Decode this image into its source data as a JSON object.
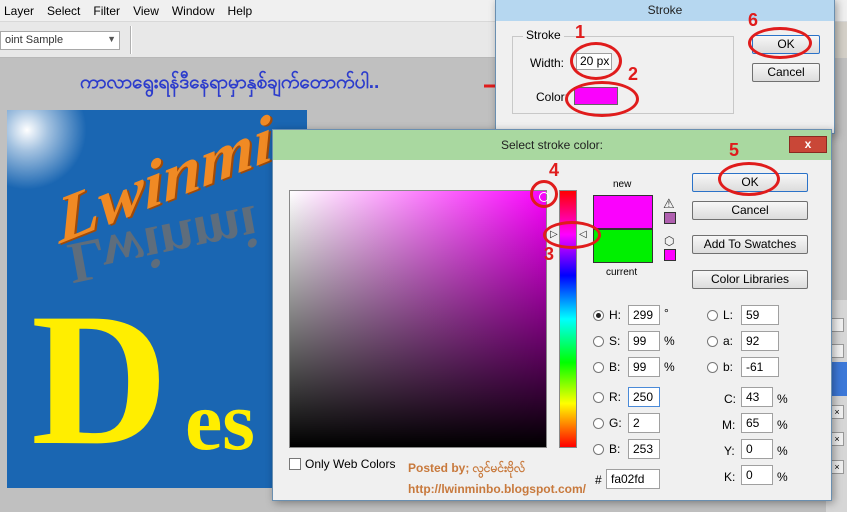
{
  "menu": [
    "Layer",
    "Select",
    "Filter",
    "View",
    "Window",
    "Help"
  ],
  "options_bar": {
    "sample_value": "oint Sample"
  },
  "artwork": {
    "word": "Lwinmi",
    "big_d": "D",
    "big_es": "es"
  },
  "instruction_text": "ကာလာရွေးရန်ဒီနေရာမှာနှစ်ချက်တောက်ပါ..",
  "stroke_dialog": {
    "title": "Stroke",
    "group_title": "Stroke",
    "width_label": "Width:",
    "width_value": "20 px",
    "color_label": "Color:",
    "ok_label": "OK",
    "cancel_label": "Cancel",
    "color_value": "#fa02fd"
  },
  "picker": {
    "title": "Select stroke color:",
    "close_label": "x",
    "label_new": "new",
    "label_current": "current",
    "ok_label": "OK",
    "cancel_label": "Cancel",
    "add_swatches_label": "Add To Swatches",
    "color_libraries_label": "Color Libraries",
    "only_web_label": "Only Web Colors",
    "hex_prefix": "#",
    "hex_value": "fa02fd",
    "new_color": "#fa02fd",
    "current_color": "#00f000",
    "hsb": {
      "H": "299",
      "S": "99",
      "B": "99",
      "h_unit": "°",
      "s_unit": "%",
      "b_unit": "%"
    },
    "rgb": {
      "R": "250",
      "G": "2",
      "B": "253"
    },
    "lab": {
      "L": "59",
      "a": "92",
      "b": "-61"
    },
    "cmyk": {
      "C": "43",
      "M": "65",
      "Y": "0",
      "K": "0",
      "unit": "%"
    },
    "labels": {
      "H": "H:",
      "S": "S:",
      "Bb": "B:",
      "R": "R:",
      "G": "G:",
      "Br": "B:",
      "L": "L:",
      "a": "a:",
      "b": "b:",
      "C": "C:",
      "M": "M:",
      "Y": "Y:",
      "K": "K:"
    }
  },
  "posted_by": "Posted by; လွင်မင်းဗိုလ်",
  "blog_url": "http://lwinminbo.blogspot.com/",
  "annotations": [
    "1",
    "2",
    "3",
    "4",
    "5",
    "6"
  ],
  "colors": {
    "accent_red": "#e01c1c",
    "instruction_blue": "#2c3ccc",
    "posted_brown": "#c8793c"
  }
}
